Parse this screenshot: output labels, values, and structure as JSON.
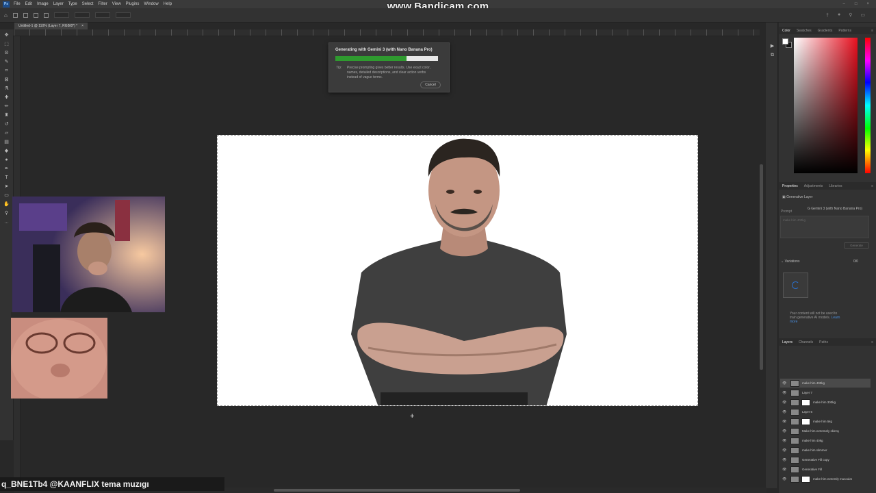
{
  "watermark": "www.Bandicam.com",
  "menubar": {
    "logo": "Ps",
    "items": [
      "File",
      "Edit",
      "Image",
      "Layer",
      "Type",
      "Select",
      "Filter",
      "View",
      "Plugins",
      "Window",
      "Help"
    ]
  },
  "document_tab": {
    "title": "Untitled-1 @ 110% (Layer 7, RGB/8*) *",
    "close": "×"
  },
  "dialog": {
    "title": "Generating with Gemini 3 (with Nano Banana Pro)",
    "progress": 0.69,
    "tip_label": "Tip:",
    "tip_text": "Precise prompting gives better results. Use exact color, names, detailed descriptions, and clear action verbs instead of vague terms.",
    "cancel_label": "Cancel"
  },
  "panels": {
    "color_tabs": [
      "Color",
      "Swatches",
      "Gradients",
      "Patterns"
    ],
    "properties_tabs": [
      "Properties",
      "Adjustments",
      "Libraries"
    ],
    "generative_layer_label": "Generative Layer",
    "model_label": "Gemini 3 (with Nano Banana Pro)",
    "prompt_label": "Prompt",
    "prompt_placeholder": "make him 400kg",
    "generate_label": "Generate",
    "variations_label": "Variations",
    "variations_count": "0/0",
    "notice": "Your content will not be used to train generative AI models.",
    "learn_more": "Learn more",
    "layers_tabs": [
      "Layers",
      "Channels",
      "Paths"
    ]
  },
  "layers": [
    {
      "name": "make him 400kg",
      "selected": true,
      "mask": false
    },
    {
      "name": "Layer 7",
      "selected": false,
      "mask": false
    },
    {
      "name": "make him 300kg",
      "selected": false,
      "mask": true
    },
    {
      "name": "Layer 6",
      "selected": false,
      "mask": false
    },
    {
      "name": "make him 5kg",
      "selected": false,
      "mask": true
    },
    {
      "name": "Make him extremely skinny",
      "selected": false,
      "mask": false
    },
    {
      "name": "make him 40kg",
      "selected": false,
      "mask": false
    },
    {
      "name": "make him slimmer",
      "selected": false,
      "mask": false
    },
    {
      "name": "Generative Fill copy",
      "selected": false,
      "mask": false
    },
    {
      "name": "Generative Fill",
      "selected": false,
      "mask": false
    },
    {
      "name": "make him extremly muscular",
      "selected": false,
      "mask": true
    }
  ],
  "overlay": {
    "text": "q_BNE1Tb4 @KAANFLIX tema muzıgı"
  },
  "colors": {
    "progress_fill": "#2f9a2f",
    "color_field_hue": "#e8101f"
  }
}
